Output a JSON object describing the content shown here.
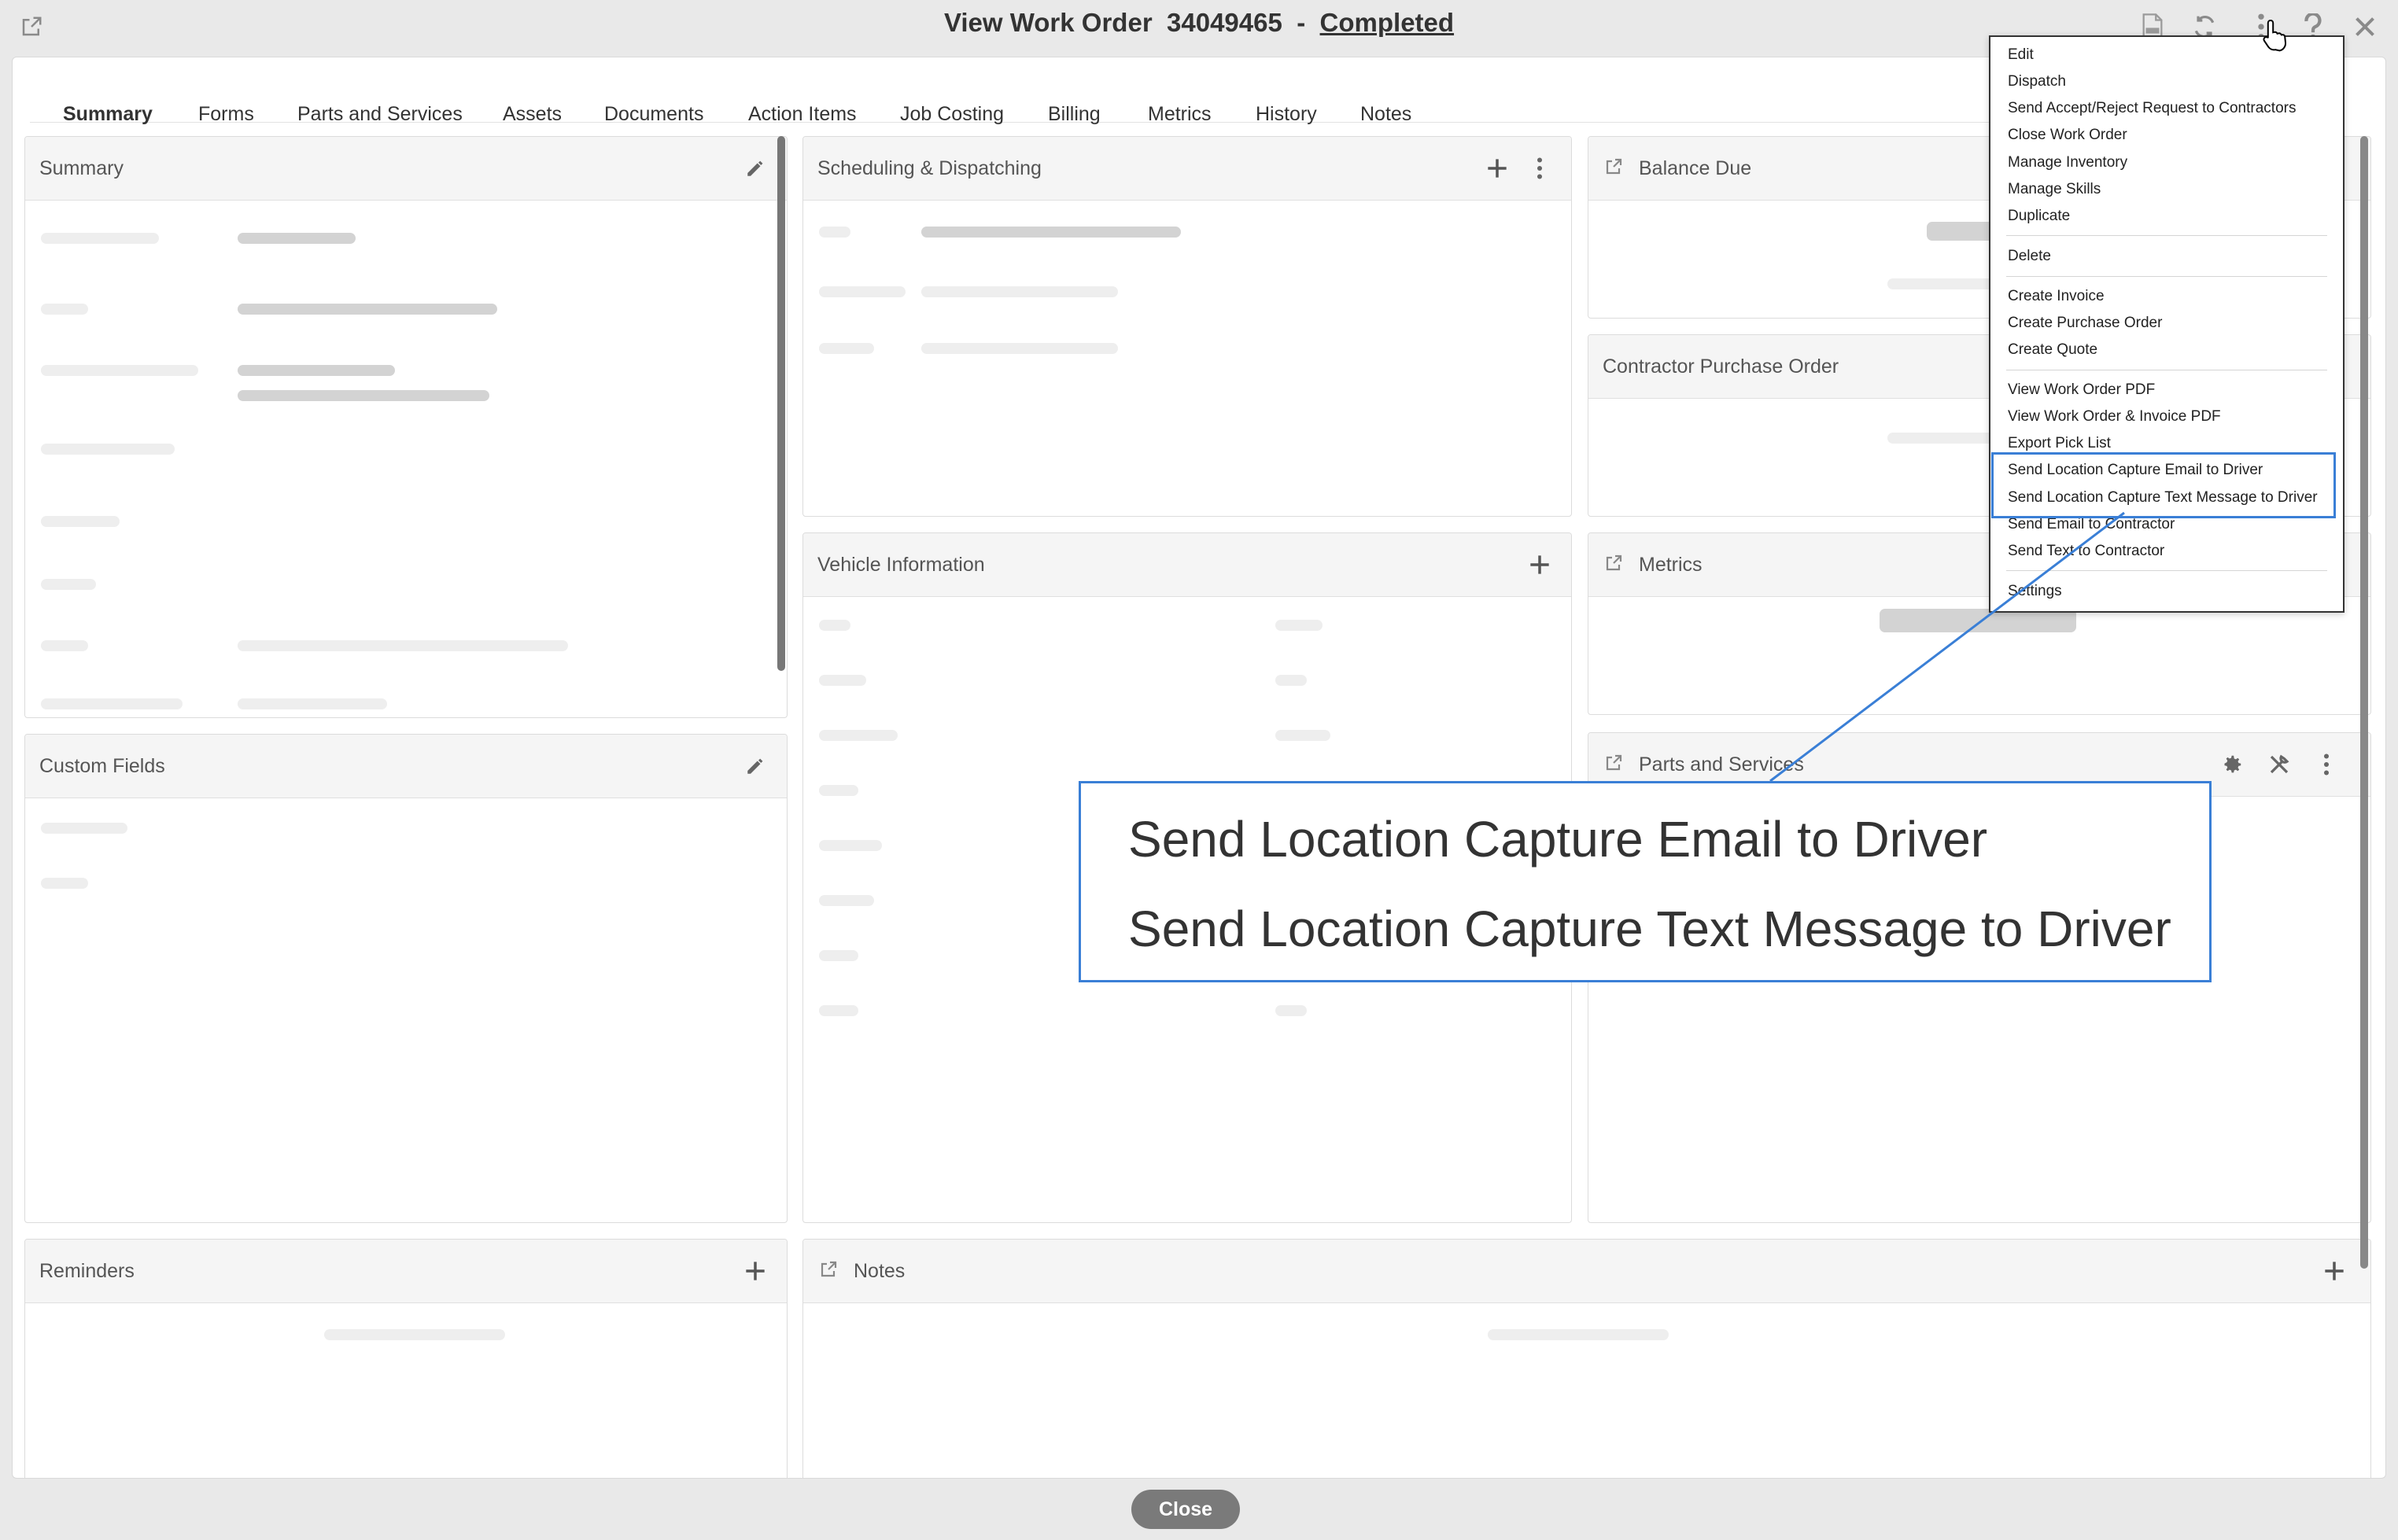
{
  "window": {
    "title_prefix": "View Work Order",
    "work_order_number": "34049465",
    "separator": "-",
    "status": "Completed"
  },
  "tabs": [
    {
      "label": "Summary",
      "active": true
    },
    {
      "label": "Forms"
    },
    {
      "label": "Parts and Services"
    },
    {
      "label": "Assets"
    },
    {
      "label": "Documents"
    },
    {
      "label": "Action Items"
    },
    {
      "label": "Job Costing"
    },
    {
      "label": "Billing"
    },
    {
      "label": "Metrics"
    },
    {
      "label": "History"
    },
    {
      "label": "Notes"
    }
  ],
  "panels": {
    "summary": {
      "title": "Summary"
    },
    "scheduling": {
      "title": "Scheduling & Dispatching"
    },
    "balance_due": {
      "title": "Balance Due"
    },
    "contractor_po": {
      "title": "Contractor Purchase Order"
    },
    "custom_fields": {
      "title": "Custom Fields"
    },
    "vehicle_info": {
      "title": "Vehicle Information"
    },
    "metrics": {
      "title": "Metrics"
    },
    "parts_services": {
      "title": "Parts and Services"
    },
    "reminders": {
      "title": "Reminders"
    },
    "notes": {
      "title": "Notes"
    }
  },
  "menu": {
    "items": [
      "Edit",
      "Dispatch",
      "Send Accept/Reject Request to Contractors",
      "Close Work Order",
      "Manage Inventory",
      "Manage Skills",
      "Duplicate",
      "Delete",
      "Create Invoice",
      "Create Purchase Order",
      "Create Quote",
      "View Work Order PDF",
      "View Work Order & Invoice PDF",
      "Export Pick List",
      "Send Location Capture Email to Driver",
      "Send Location Capture Text Message to Driver",
      "Send Email to Contractor",
      "Send Text to Contractor",
      "Settings"
    ]
  },
  "zoom": {
    "line1": "Send Location Capture Email to Driver",
    "line2": "Send Location Capture Text Message to Driver"
  },
  "footer": {
    "close_label": "Close"
  },
  "colors": {
    "accent": "#e0602a",
    "highlight": "#3a7fd6",
    "close_button": "#7a7a7a"
  }
}
